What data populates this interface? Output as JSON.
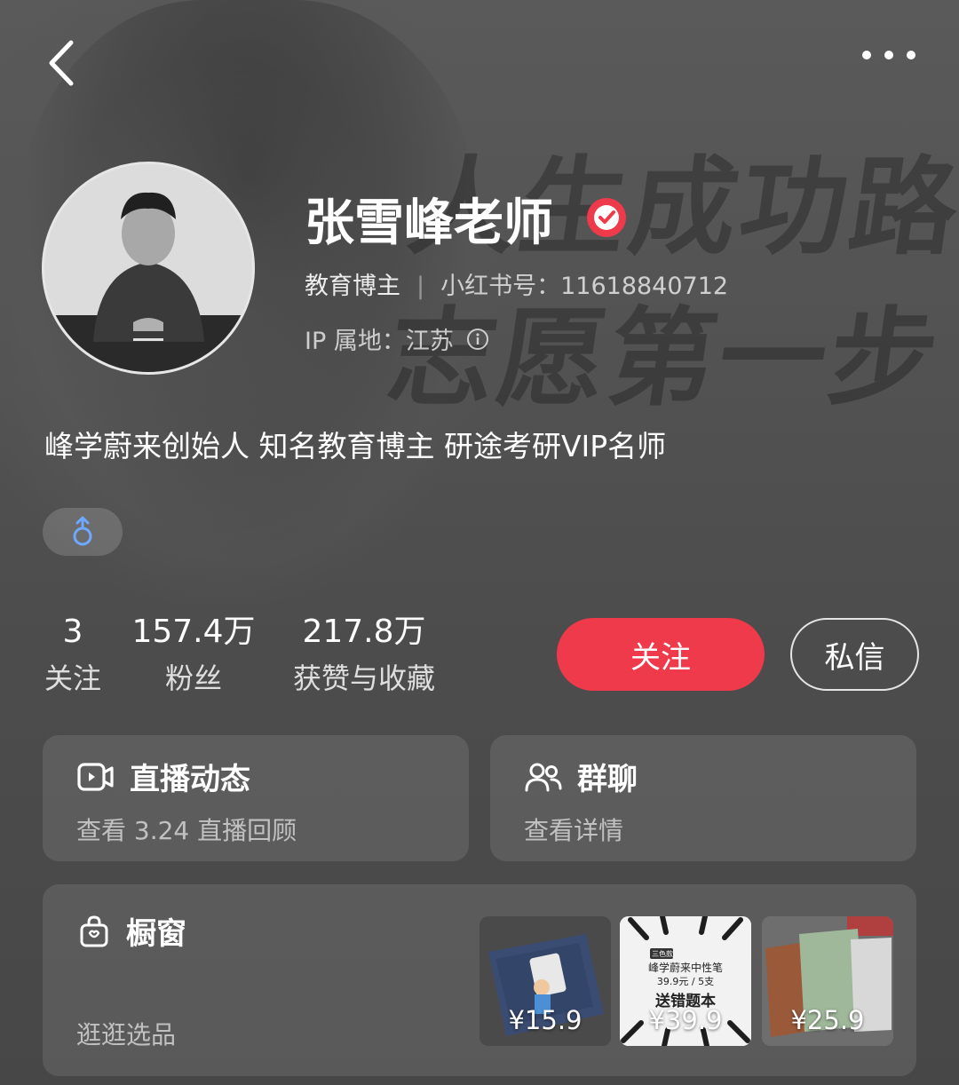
{
  "profile": {
    "name": "张雪峰老师",
    "role": "教育博主",
    "id_label": "小红书号：11618840712",
    "ip_label": "IP 属地：江苏",
    "bio": "峰学蔚来创始人 知名教育博主 研途考研VIP名师",
    "gender_symbol": "♂"
  },
  "background": {
    "slogan_line1": "人生成功路",
    "slogan_line2": "志愿第一步"
  },
  "stats": [
    {
      "value": "3",
      "label": "关注"
    },
    {
      "value": "157.4万",
      "label": "粉丝"
    },
    {
      "value": "217.8万",
      "label": "获赞与收藏"
    }
  ],
  "actions": {
    "follow": "关注",
    "message": "私信"
  },
  "cards": {
    "live": {
      "title": "直播动态",
      "subtitle": "查看 3.24 直播回顾"
    },
    "group": {
      "title": "群聊",
      "subtitle": "查看详情"
    },
    "shop": {
      "title": "橱窗",
      "subtitle": "逛逛选品"
    }
  },
  "products": [
    {
      "price": "¥15.9"
    },
    {
      "price": "¥39.9",
      "tag": "三色款",
      "name": "峰学蔚来中性笔",
      "offer": "39.9元 / 5支",
      "gift": "送错题本"
    },
    {
      "price": "¥25.9"
    }
  ],
  "colors": {
    "follow_button": "#ee3a4a",
    "verified_badge": "#ee3a4a",
    "gender_icon": "#6ea8ff"
  },
  "icons": {
    "back": "chevron-left-icon",
    "more": "more-dots-icon",
    "verified": "verified-check-icon",
    "info": "info-circle-icon",
    "gender": "male-gender-icon",
    "live": "video-camera-icon",
    "group": "group-users-icon",
    "shop": "shopping-bag-icon"
  }
}
